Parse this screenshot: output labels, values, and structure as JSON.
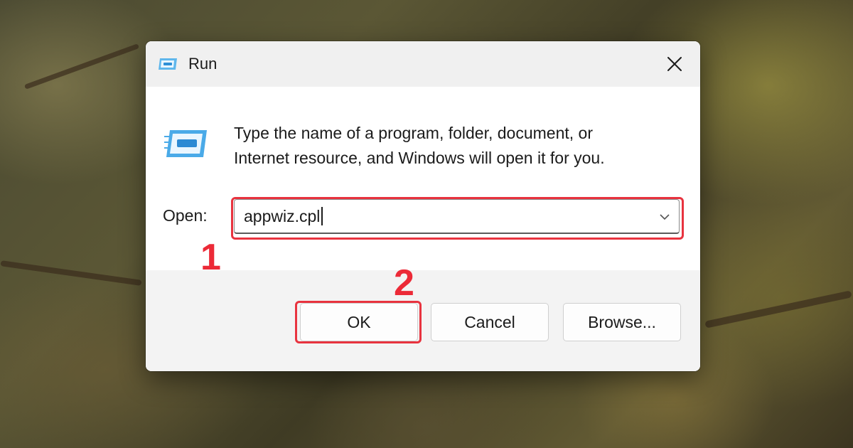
{
  "window": {
    "title": "Run"
  },
  "content": {
    "description_line1": "Type the name of a program, folder, document, or",
    "description_line2": "Internet resource, and Windows will open it for you.",
    "open_label": "Open:",
    "open_value": "appwiz.cpl"
  },
  "buttons": {
    "ok": "OK",
    "cancel": "Cancel",
    "browse": "Browse..."
  },
  "annotations": {
    "step1": "1",
    "step2": "2",
    "highlight_color": "#e8333f"
  },
  "icons": {
    "title": "run-icon",
    "close": "close-icon",
    "large": "run-icon",
    "dropdown": "chevron-down-icon"
  }
}
